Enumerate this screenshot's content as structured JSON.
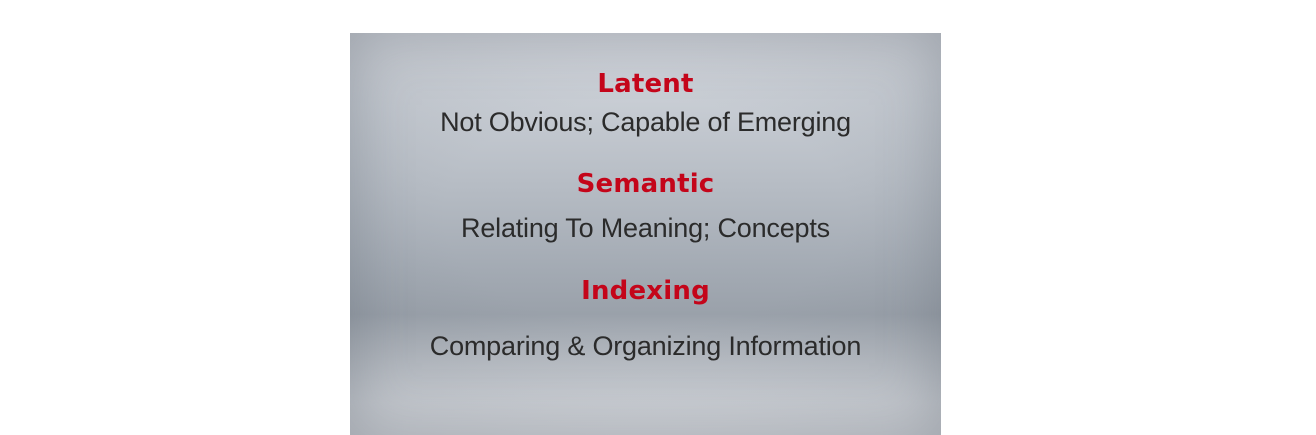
{
  "slide": {
    "entries": [
      {
        "term": "Latent",
        "description": "Not Obvious; Capable of Emerging"
      },
      {
        "term": "Semantic",
        "description": "Relating To Meaning; Concepts"
      },
      {
        "term": "Indexing",
        "description": "Comparing & Organizing Information"
      }
    ],
    "colors": {
      "term": "#c4051a",
      "description": "#2b2b2b",
      "background_top": "#d6d9df",
      "background_bottom": "#dfe1e5"
    }
  }
}
